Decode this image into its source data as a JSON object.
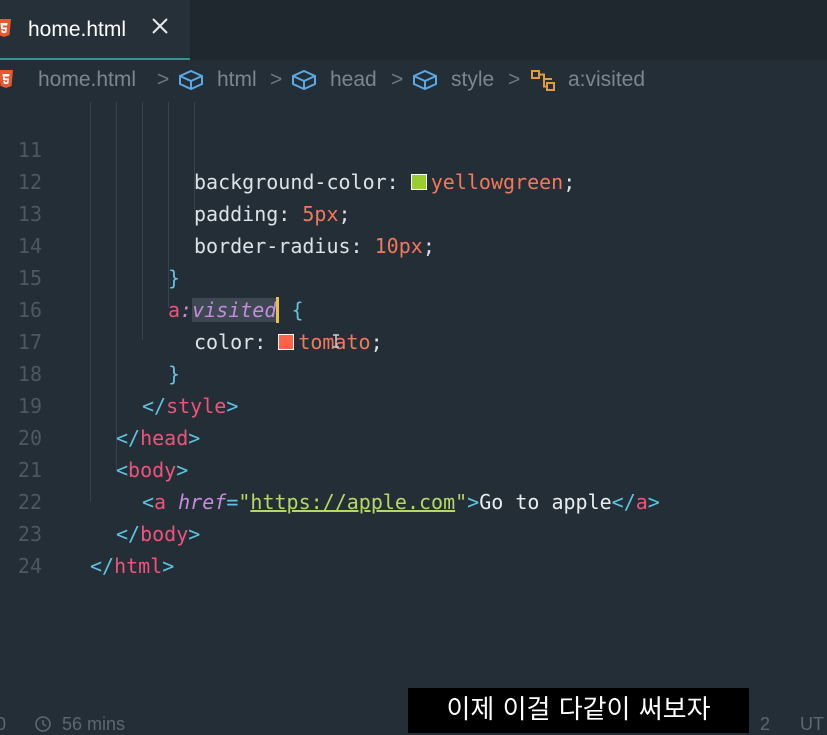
{
  "tab": {
    "label": "home.html",
    "icon": "html5-icon",
    "close_icon": "close-icon"
  },
  "breadcrumb": {
    "items": [
      "home.html",
      "html",
      "head",
      "style",
      "a:visited"
    ],
    "icons": [
      "html5-icon",
      "element-cube-icon",
      "element-cube-icon",
      "element-cube-icon",
      "css-selector-icon"
    ],
    "separator": ">"
  },
  "editor": {
    "line_numbers": [
      "11",
      "12",
      "13",
      "14",
      "15",
      "16",
      "17",
      "18",
      "19",
      "20",
      "21",
      "22",
      "23",
      "24"
    ],
    "lines": {
      "l11": {
        "prop": "background-color",
        "colon": ": ",
        "value": "yellowgreen",
        "end": ";",
        "swatch": "#9acd32"
      },
      "l12": {
        "prop": "padding",
        "colon": ": ",
        "value": "5px",
        "end": ";"
      },
      "l13": {
        "prop": "border-radius",
        "colon": ": ",
        "value": "10px",
        "end": ";"
      },
      "l14": {
        "brace": "}"
      },
      "l15": {
        "tag": "a",
        "colon": ":",
        "pseudo": "visited",
        "brace": "{"
      },
      "l16": {
        "prop": "color",
        "colon": ": ",
        "value": "tomato",
        "end": ";",
        "swatch": "#ff6347"
      },
      "l17": {
        "brace": "}"
      },
      "l18": {
        "open": "</",
        "tag": "style",
        "close": ">"
      },
      "l19": {
        "open": "</",
        "tag": "head",
        "close": ">"
      },
      "l20": {
        "open": "<",
        "tag": "body",
        "close": ">"
      },
      "l21": {
        "open": "<",
        "tag": "a",
        "attr": "href",
        "eq": "=",
        "q": "\"",
        "url": "https://apple.com",
        "close": ">",
        "text": "Go to apple",
        "end_open": "</",
        "end_tag": "a",
        "end_close": ">"
      },
      "l22": {
        "open": "</",
        "tag": "body",
        "close": ">"
      },
      "l23": {
        "open": "</",
        "tag": "html",
        "close": ">"
      }
    }
  },
  "status": {
    "left": "0",
    "time": "56 mins",
    "right_num": "2",
    "encoding": "UT"
  },
  "subtitle": "이제 이걸 다같이 써보자",
  "colors": {
    "background": "#242e37",
    "tag": "#f0537a",
    "value": "#f2785c",
    "string": "#b6d865",
    "brace": "#5fc3e4"
  }
}
